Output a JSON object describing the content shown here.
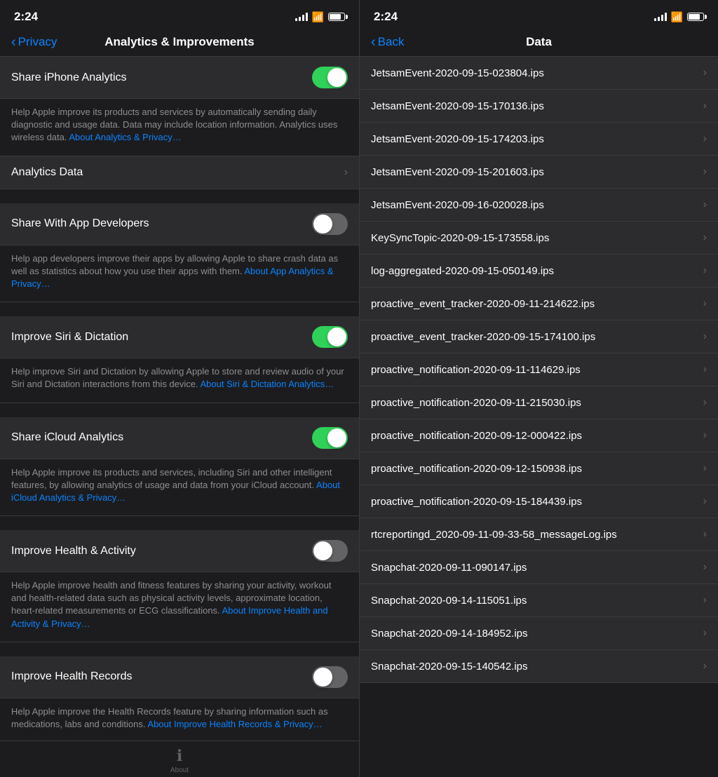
{
  "left": {
    "statusBar": {
      "time": "2:24"
    },
    "navBar": {
      "backLabel": "Privacy",
      "title": "Analytics & Improvements"
    },
    "settings": [
      {
        "id": "share-iphone-analytics",
        "label": "Share iPhone Analytics",
        "toggle": true,
        "description": "Help Apple improve its products and services by automatically sending daily diagnostic and usage data. Data may include location information. Analytics uses wireless data.",
        "linkText": "About Analytics & Privacy…",
        "linkHref": "#"
      },
      {
        "id": "analytics-data",
        "label": "Analytics Data",
        "chevron": true,
        "description": null
      },
      {
        "id": "share-with-app-developers",
        "label": "Share With App Developers",
        "toggle": false,
        "description": "Help app developers improve their apps by allowing Apple to share crash data as well as statistics about how you use their apps with them.",
        "linkText": "About App Analytics & Privacy…",
        "linkHref": "#"
      },
      {
        "id": "improve-siri-dictation",
        "label": "Improve Siri & Dictation",
        "toggle": true,
        "description": "Help improve Siri and Dictation by allowing Apple to store and review audio of your Siri and Dictation interactions from this device.",
        "linkText": "About Siri & Dictation Analytics…",
        "linkHref": "#"
      },
      {
        "id": "share-icloud-analytics",
        "label": "Share iCloud Analytics",
        "toggle": true,
        "description": "Help Apple improve its products and services, including Siri and other intelligent features, by allowing analytics of usage and data from your iCloud account.",
        "linkText": "About iCloud Analytics & Privacy…",
        "linkHref": "#"
      },
      {
        "id": "improve-health-activity",
        "label": "Improve Health & Activity",
        "toggle": false,
        "description": "Help Apple improve health and fitness features by sharing your activity, workout and health-related data such as physical activity levels, approximate location, heart-related measurements or ECG classifications.",
        "linkText": "About Improve Health and Activity & Privacy…",
        "linkHref": "#"
      },
      {
        "id": "improve-health-records",
        "label": "Improve Health Records",
        "toggle": false,
        "description": "Help Apple improve the Health Records feature by sharing information such as medications, labs and conditions.",
        "linkText": "About Improve Health Records & Privacy…",
        "linkHref": "#"
      }
    ],
    "tabBar": {
      "items": [
        {
          "id": "tab-about",
          "icon": "ℹ️",
          "label": "About"
        }
      ]
    }
  },
  "right": {
    "statusBar": {
      "time": "2:24"
    },
    "navBar": {
      "backLabel": "Back",
      "title": "Data"
    },
    "files": [
      "JetsamEvent-2020-09-15-023804.ips",
      "JetsamEvent-2020-09-15-170136.ips",
      "JetsamEvent-2020-09-15-174203.ips",
      "JetsamEvent-2020-09-15-201603.ips",
      "JetsamEvent-2020-09-16-020028.ips",
      "KeySyncTopic-2020-09-15-173558.ips",
      "log-aggregated-2020-09-15-050149.ips",
      "proactive_event_tracker-2020-09-11-214622.ips",
      "proactive_event_tracker-2020-09-15-174100.ips",
      "proactive_notification-2020-09-11-114629.ips",
      "proactive_notification-2020-09-11-215030.ips",
      "proactive_notification-2020-09-12-000422.ips",
      "proactive_notification-2020-09-12-150938.ips",
      "proactive_notification-2020-09-15-184439.ips",
      "rtcreportingd_2020-09-11-09-33-58_messageLog.ips",
      "Snapchat-2020-09-11-090147.ips",
      "Snapchat-2020-09-14-115051.ips",
      "Snapchat-2020-09-14-184952.ips",
      "Snapchat-2020-09-15-140542.ips"
    ]
  }
}
